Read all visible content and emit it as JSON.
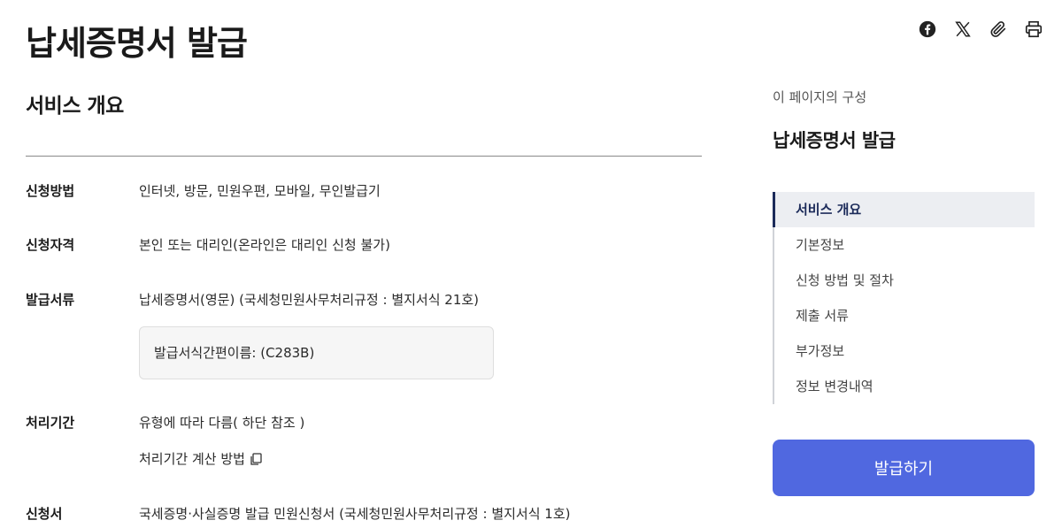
{
  "page": {
    "title": "납세증명서 발급"
  },
  "share": {
    "icons": [
      "facebook-icon",
      "x-icon",
      "paperclip-icon",
      "print-icon"
    ]
  },
  "overview": {
    "title": "서비스 개요",
    "rows": [
      {
        "label": "신청방법",
        "value": "인터넷, 방문, 민원우편, 모바일, 무인발급기"
      },
      {
        "label": "신청자격",
        "value": "본인 또는 대리인(온라인은 대리인 신청 불가)"
      },
      {
        "label": "발급서류",
        "value": "납세증명서(영문) (국세청민원사무처리규정 : 별지서식 21호)"
      },
      {
        "label": "처리기간",
        "value": "유형에 따라 다름( 하단 참조 )"
      },
      {
        "label": "신청서",
        "value": "국세증명·사실증명 발급 민원신청서 (국세청민원사무처리규정 : 별지서식 1호)"
      }
    ],
    "form_box_text": "발급서식간편이름: (C283B)",
    "calc_link": "처리기간 계산 방법"
  },
  "toc": {
    "caption": "이 페이지의 구성",
    "title": "납세증명서 발급",
    "items": [
      {
        "label": "서비스 개요",
        "active": true
      },
      {
        "label": "기본정보"
      },
      {
        "label": "신청 방법 및 절차"
      },
      {
        "label": "제출 서류"
      },
      {
        "label": "부가정보"
      },
      {
        "label": "정보 변경내역"
      }
    ]
  },
  "action": {
    "issue_button": "발급하기"
  },
  "colors": {
    "accent": "#5068e0",
    "toc_active": "#1c2b5a",
    "toc_active_bg": "#eceef2"
  }
}
